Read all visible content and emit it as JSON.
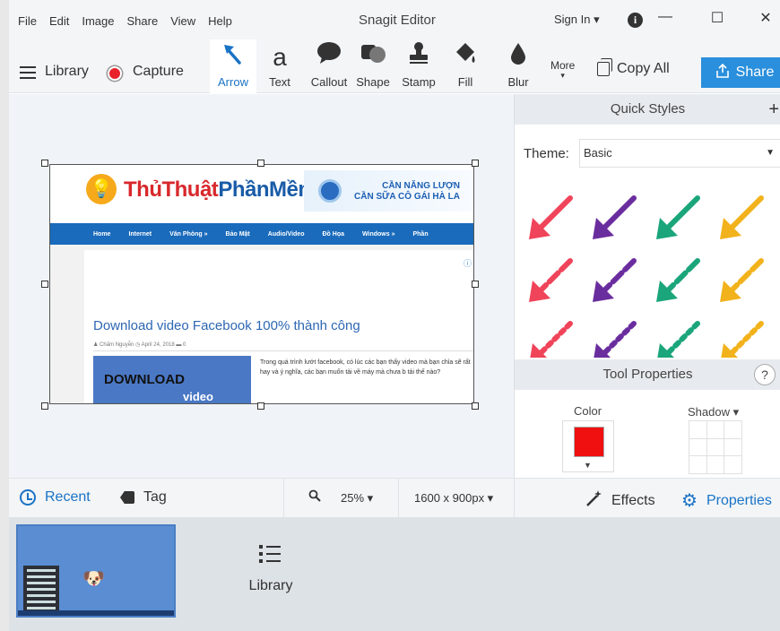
{
  "menu": [
    "File",
    "Edit",
    "Image",
    "Share",
    "View",
    "Help"
  ],
  "app_title": "Snagit Editor",
  "signin": "Sign In ▾",
  "window_controls": {
    "minimize": "—",
    "maximize": "☐",
    "close": "✕"
  },
  "toolbar": {
    "library": "Library",
    "capture": "Capture",
    "tools": [
      {
        "label": "Arrow",
        "icon": "arrow-icon",
        "active": true
      },
      {
        "label": "Text",
        "icon": "text-icon"
      },
      {
        "label": "Callout",
        "icon": "callout-icon"
      },
      {
        "label": "Shape",
        "icon": "shape-icon"
      },
      {
        "label": "Stamp",
        "icon": "stamp-icon"
      },
      {
        "label": "Fill",
        "icon": "fill-icon"
      },
      {
        "label": "Blur",
        "icon": "blur-icon"
      }
    ],
    "more": "More",
    "copy_all": "Copy All",
    "share": "Share",
    "accent": "#2a8fdc"
  },
  "capture": {
    "logo_text_1": "ThủThuật",
    "logo_text_2": "PhầnMềm",
    "ad_line1": "CẦN NĂNG LƯỢN",
    "ad_line2": "CẦN SỮA CÔ GÁI HÀ LA",
    "nav": [
      "Home",
      "Internet",
      "Văn Phòng »",
      "Bảo Mật",
      "Audio/Video",
      "Đồ Họa",
      "Windows »",
      "Phần"
    ],
    "adlink": "ⓘ",
    "post_title": "Download video Facebook 100% thành công",
    "post_meta": "♟ Chấm Nguyễn  ◷ April 24, 2018  ▬ 0",
    "thumb_title": "DOWNLOAD",
    "thumb_sub": "video",
    "post_text": "Trong quá trình lướt facebook, có lúc các bạn thấy video mà bạn chỉa sẽ rất hay và ý nghĩa, các bạn muốn tải về máy mà chưa b tải thế nào?"
  },
  "right_panel": {
    "quick_styles": "Quick Styles",
    "plus": "+",
    "theme_label": "Theme:",
    "theme_value": "Basic",
    "arrow_colors": [
      "#f0445a",
      "#6a2d9e",
      "#1aa57a",
      "#f2b21c"
    ],
    "tool_properties": "Tool Properties",
    "help": "?",
    "color_label": "Color",
    "color_value": "#f01010",
    "shadow_label": "Shadow ▾"
  },
  "bottombar": {
    "recent": "Recent",
    "tag": "Tag",
    "zoom": "25% ▾",
    "size": "1600 x 900px ▾",
    "effects": "Effects",
    "properties": "Properties"
  },
  "tray": {
    "library": "Library"
  }
}
